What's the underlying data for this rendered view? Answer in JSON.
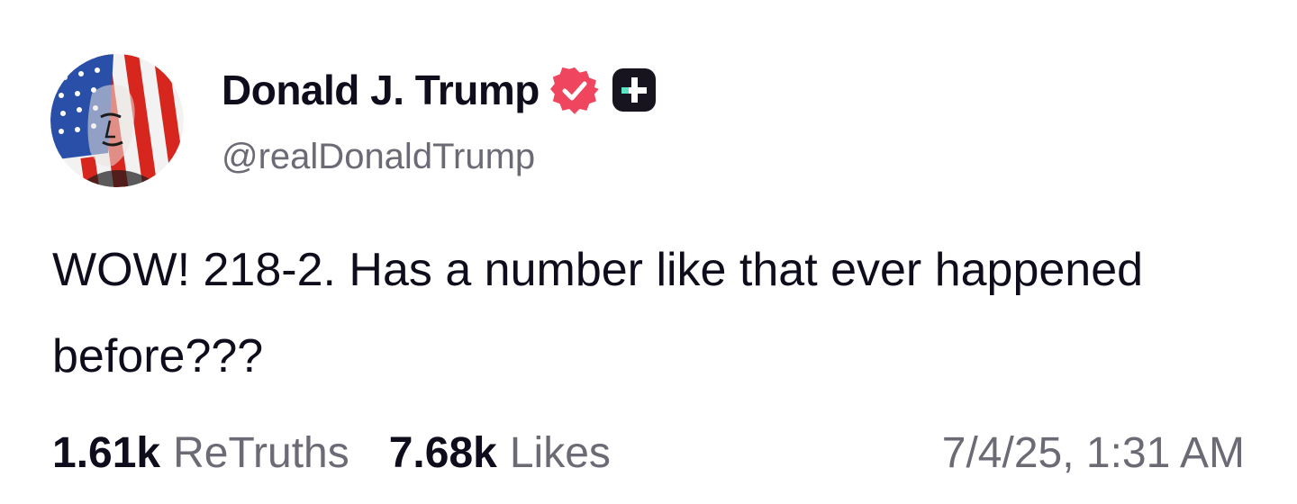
{
  "post": {
    "author": {
      "display_name": "Donald J. Trump",
      "handle": "@realDonaldTrump",
      "verified": true,
      "badges": [
        "verified-icon",
        "plus-icon"
      ],
      "colors": {
        "verified": "#f0455f",
        "plus_badge_bg": "#17141f",
        "plus_badge_accent": "#5be4c4"
      }
    },
    "text": "WOW! 218-2. Has a number like that ever happened before???",
    "stats": {
      "retruths_count": "1.61k",
      "retruths_label": "ReTruths",
      "likes_count": "7.68k",
      "likes_label": "Likes"
    },
    "timestamp": "7/4/25, 1:31 AM"
  }
}
